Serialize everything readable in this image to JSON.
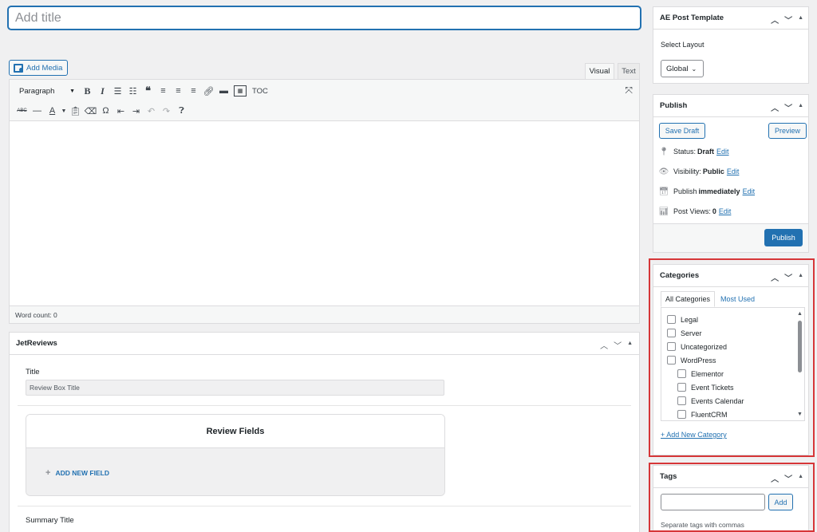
{
  "title": {
    "placeholder": "Add title"
  },
  "editor": {
    "add_media": "Add Media",
    "tabs": {
      "visual": "Visual",
      "text": "Text"
    },
    "format_select": "Paragraph",
    "toc": "TOC",
    "word_count": "Word count: 0",
    "row1_icons": [
      "bold-icon",
      "italic-icon",
      "bullet-list-icon",
      "numbered-list-icon",
      "blockquote-icon",
      "align-left-icon",
      "align-center-icon",
      "align-right-icon",
      "link-icon",
      "read-more-icon",
      "toolbar-toggle-icon"
    ],
    "row2_icons": [
      "strikethrough-icon",
      "horizontal-line-icon",
      "text-color-icon",
      "paste-text-icon",
      "clear-formatting-icon",
      "special-character-icon",
      "outdent-icon",
      "indent-icon",
      "undo-icon",
      "redo-icon",
      "help-icon"
    ]
  },
  "jetreviews": {
    "heading": "JetReviews",
    "title_label": "Title",
    "title_value": "Review Box Title",
    "review_fields_heading": "Review Fields",
    "add_field": "ADD NEW FIELD",
    "summary_label": "Summary Title"
  },
  "ae_template": {
    "heading": "AE Post Template",
    "select_label": "Select Layout",
    "layout_value": "Global"
  },
  "publish": {
    "heading": "Publish",
    "save_draft": "Save Draft",
    "preview": "Preview",
    "status_label": "Status:",
    "status_value": "Draft",
    "visibility_label": "Visibility:",
    "visibility_value": "Public",
    "schedule_label": "Publish",
    "schedule_value": "immediately",
    "views_label": "Post Views:",
    "views_value": "0",
    "edit": "Edit",
    "publish_btn": "Publish"
  },
  "categories": {
    "heading": "Categories",
    "tab_all": "All Categories",
    "tab_most": "Most Used",
    "items": [
      {
        "label": "Legal",
        "indent": 0
      },
      {
        "label": "Server",
        "indent": 0
      },
      {
        "label": "Uncategorized",
        "indent": 0
      },
      {
        "label": "WordPress",
        "indent": 0
      },
      {
        "label": "Elementor",
        "indent": 1
      },
      {
        "label": "Event Tickets",
        "indent": 1
      },
      {
        "label": "Events Calendar",
        "indent": 1
      },
      {
        "label": "FluentCRM",
        "indent": 1
      }
    ],
    "add_new": "+ Add New Category"
  },
  "tags": {
    "heading": "Tags",
    "add": "Add",
    "hint": "Separate tags with commas"
  },
  "colors": {
    "accent": "#2271b1",
    "highlight": "#d63638"
  }
}
